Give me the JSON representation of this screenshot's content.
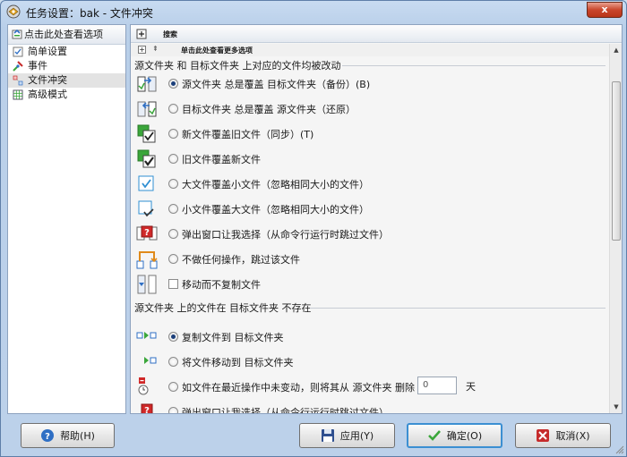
{
  "window": {
    "title": "任务设置：bak - 文件冲突",
    "close": "x"
  },
  "left_pane": {
    "header": "点击此处查看选项",
    "items": [
      {
        "label": "简单设置",
        "icon": "checklist-icon"
      },
      {
        "label": "事件",
        "icon": "event-icon"
      },
      {
        "label": "文件冲突",
        "icon": "conflict-icon",
        "selected": true
      },
      {
        "label": "高级模式",
        "icon": "grid-icon"
      }
    ]
  },
  "right_pane": {
    "header": "搜索",
    "more_options": "单击此处查看更多选项",
    "section1": {
      "title": "源文件夹 和 目标文件夹 上对应的文件均被改动",
      "options": [
        {
          "label": "源文件夹 总是覆盖 目标文件夹（备份）(B)",
          "type": "radio",
          "checked": true
        },
        {
          "label": "目标文件夹 总是覆盖 源文件夹（还原）",
          "type": "radio",
          "checked": false
        },
        {
          "label": "新文件覆盖旧文件（同步）(T)",
          "type": "radio",
          "checked": false
        },
        {
          "label": "旧文件覆盖新文件",
          "type": "radio",
          "checked": false
        },
        {
          "label": "大文件覆盖小文件（忽略相同大小的文件）",
          "type": "radio",
          "checked": false
        },
        {
          "label": "小文件覆盖大文件（忽略相同大小的文件）",
          "type": "radio",
          "checked": false
        },
        {
          "label": "弹出窗口让我选择（从命令行运行时跳过文件）",
          "type": "radio",
          "checked": false
        },
        {
          "label": "不做任何操作，跳过该文件",
          "type": "radio",
          "checked": false
        },
        {
          "label": "移动而不复制文件",
          "type": "checkbox",
          "checked": false
        }
      ]
    },
    "section2": {
      "title": "源文件夹 上的文件在 目标文件夹 不存在",
      "options": [
        {
          "label": "复制文件到 目标文件夹",
          "type": "radio",
          "checked": true
        },
        {
          "label": "将文件移动到 目标文件夹",
          "type": "radio",
          "checked": false
        },
        {
          "label": "如文件在最近操作中未变动，则将其从 源文件夹 删除",
          "type": "radio",
          "checked": false,
          "input_value": "0",
          "unit": "天"
        },
        {
          "label": "弹出窗口让我选择（从命令行运行时跳过文件）",
          "type": "radio",
          "checked": false
        }
      ]
    }
  },
  "buttons": {
    "help": "帮助(H)",
    "apply": "应用(Y)",
    "ok": "确定(O)",
    "cancel": "取消(X)"
  },
  "colors": {
    "accent": "#3b8fd2",
    "green": "#3aa63a",
    "red": "#c62b2b",
    "blue": "#2f6fc4"
  }
}
